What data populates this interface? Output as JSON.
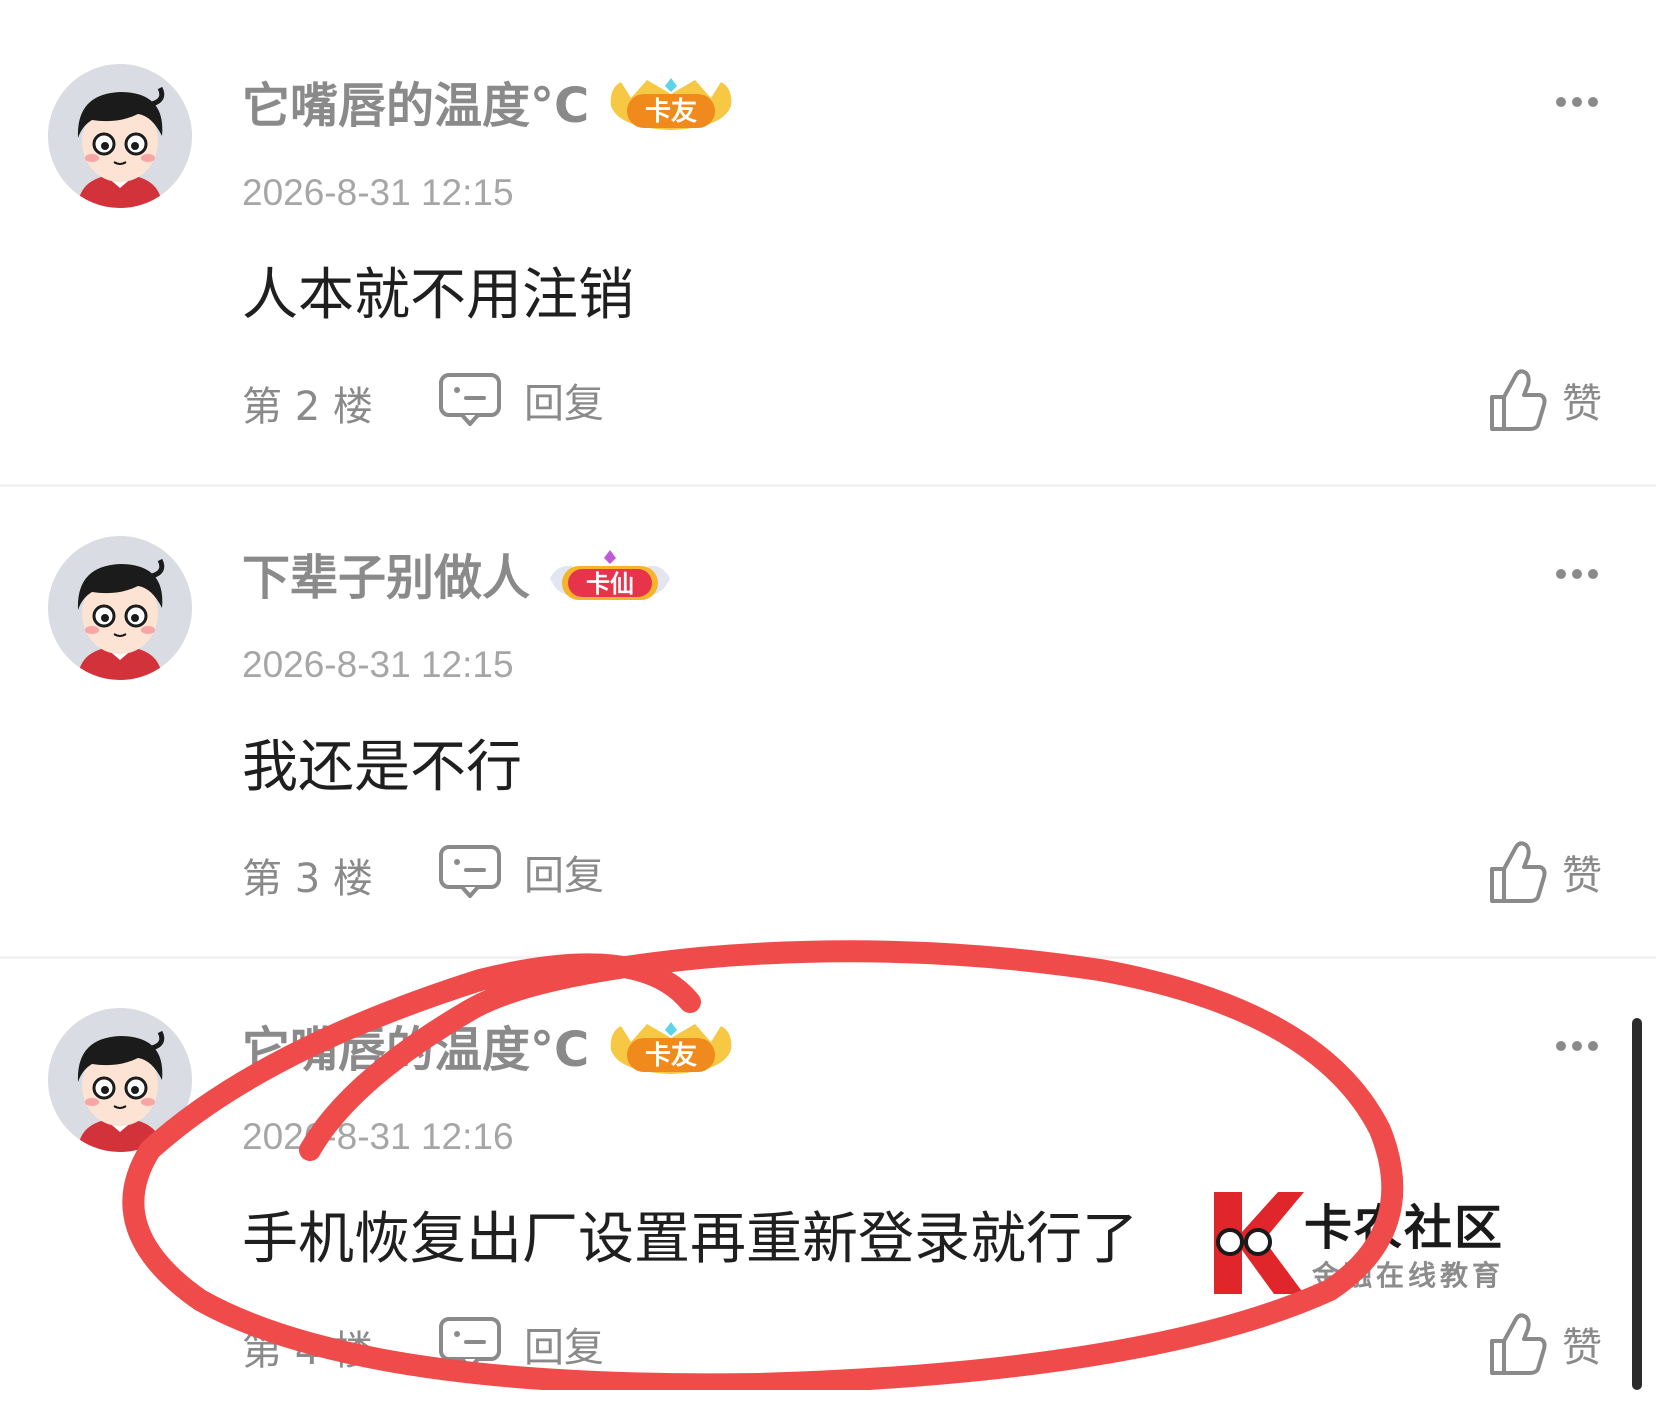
{
  "comments": [
    {
      "username": "它嘴唇的温度°C",
      "badge": "卡友",
      "timestamp": "2026-8-31 12:15",
      "content": "人本就不用注销",
      "floor": "第 2 楼",
      "reply_label": "回复",
      "like_label": "赞"
    },
    {
      "username": "下辈子别做人",
      "badge": "卡仙",
      "timestamp": "2026-8-31 12:15",
      "content": "我还是不行",
      "floor": "第 3 楼",
      "reply_label": "回复",
      "like_label": "赞"
    },
    {
      "username": "它嘴唇的温度°C",
      "badge": "卡友",
      "timestamp": "2026-8-31 12:16",
      "content": "手机恢复出厂设置再重新登录就行了",
      "floor": "第 4 楼",
      "reply_label": "回复",
      "like_label": "赞"
    }
  ],
  "watermark": {
    "title": "卡农社区",
    "subtitle": "金融在线教育"
  },
  "icons": {
    "more": "more-dots-icon",
    "reply": "comment-bubble-icon",
    "like": "thumbs-up-icon",
    "badge_friend": "crown-badge-icon",
    "badge_immortal": "winged-badge-icon"
  },
  "colors": {
    "badge_orange": "#f08a1c",
    "badge_red": "#e8344a",
    "annotation_red": "#f04b4b",
    "watermark_red": "#e0262b"
  }
}
